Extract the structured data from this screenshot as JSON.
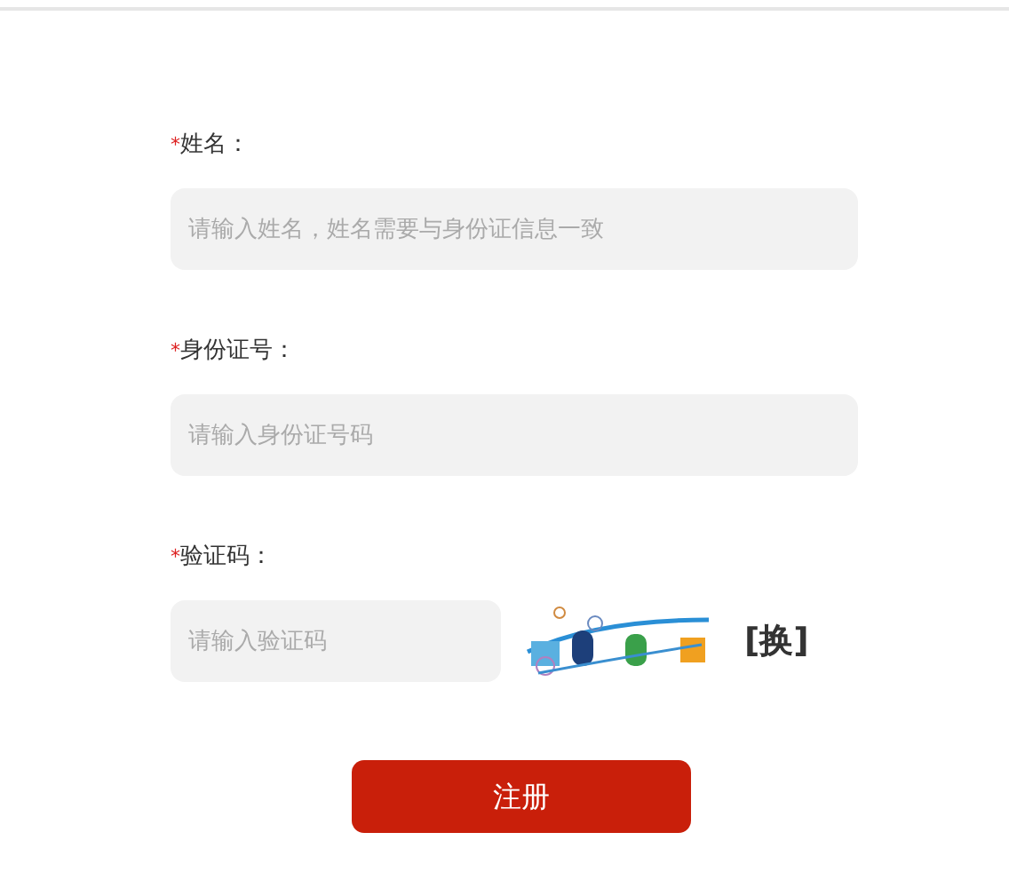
{
  "fields": [
    {
      "kind": "text",
      "label": "姓名：",
      "required_mark": "*",
      "placeholder": "请输入姓名，姓名需要与身份证信息一致"
    },
    {
      "kind": "text",
      "label": "身份证号：",
      "required_mark": "*",
      "placeholder": "请输入身份证号码"
    },
    {
      "kind": "captcha",
      "label": "验证码：",
      "required_mark": "*",
      "placeholder": "请输入验证码",
      "refresh": "[换]"
    }
  ],
  "submit": "注册"
}
